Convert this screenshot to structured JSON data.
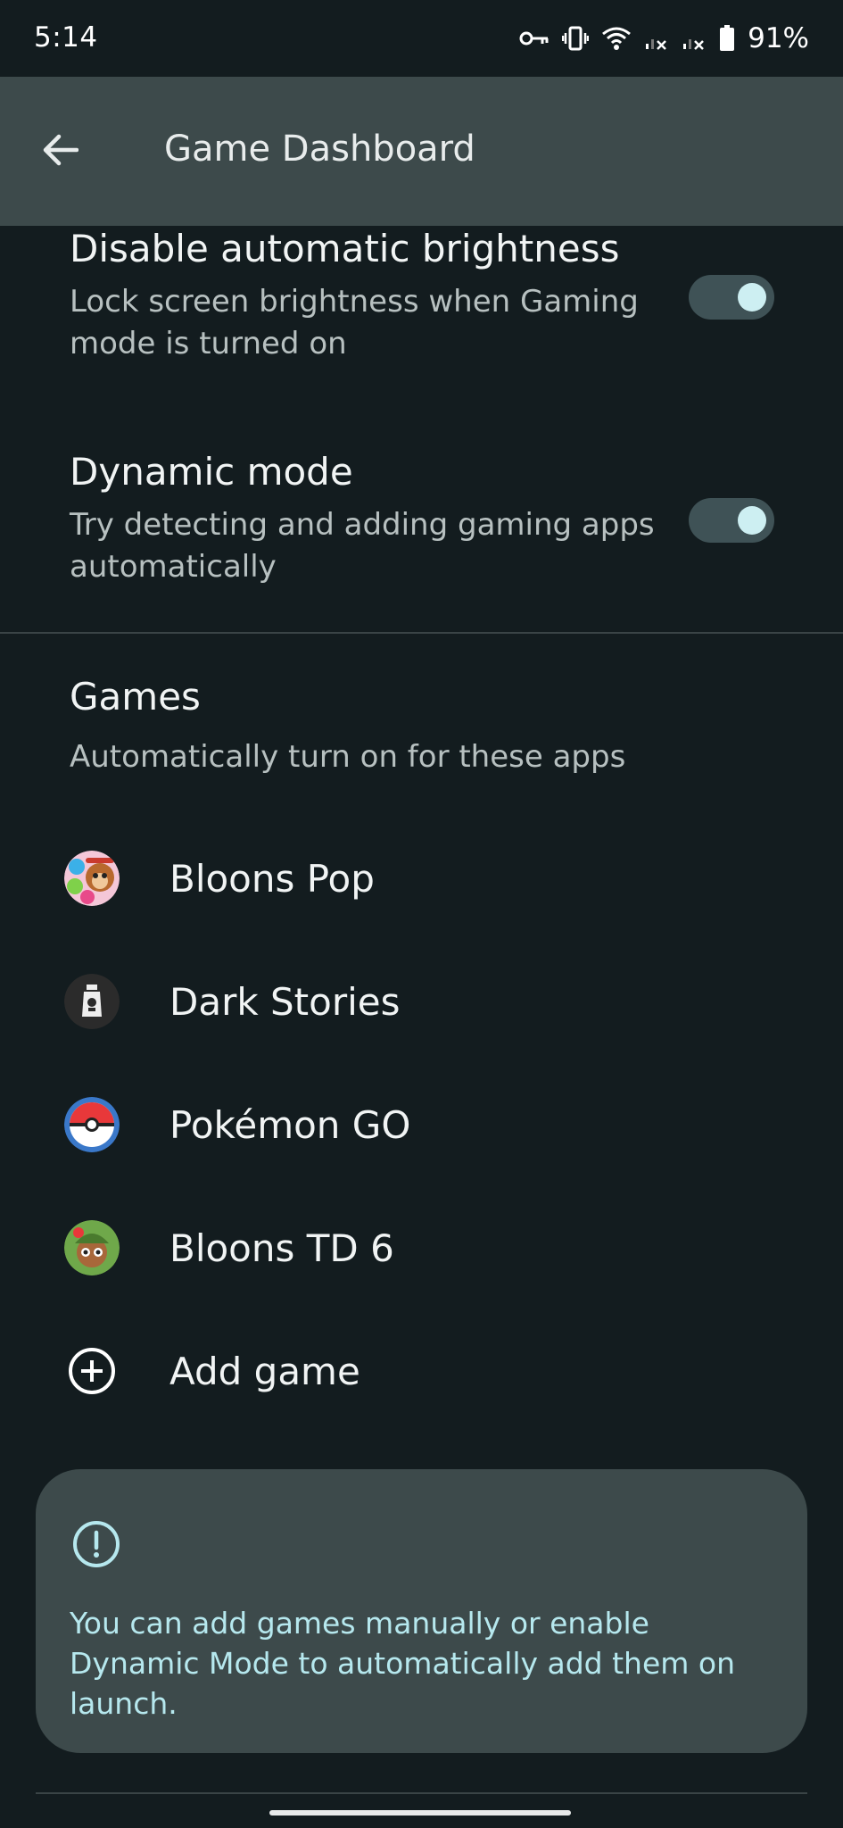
{
  "status_bar": {
    "time": "5:14",
    "battery": "91%"
  },
  "app_bar": {
    "title": "Game Dashboard"
  },
  "settings": [
    {
      "title": "Disable automatic brightness",
      "description": "Lock screen brightness when Gaming mode is turned on",
      "enabled": true
    },
    {
      "title": "Dynamic mode",
      "description": "Try detecting and adding gaming apps automatically",
      "enabled": true
    }
  ],
  "games_section": {
    "title": "Games",
    "description": "Automatically turn on for these apps",
    "games": [
      {
        "label": "Bloons Pop",
        "icon": "bloons-pop-app-icon"
      },
      {
        "label": "Dark Stories",
        "icon": "dark-stories-app-icon"
      },
      {
        "label": "Pokémon GO",
        "icon": "pokemon-go-app-icon"
      },
      {
        "label": "Bloons TD 6",
        "icon": "bloons-td6-app-icon"
      }
    ],
    "add_game_label": "Add game"
  },
  "info_card": {
    "text": "You can add games manually or enable Dynamic Mode to automatically add them on launch."
  },
  "colors": {
    "background": "#131c1f",
    "app_bar": "#3d4a4b",
    "toggle_track": "#3f5256",
    "toggle_knob": "#cdeff2",
    "info_text": "#b6e8ee"
  }
}
